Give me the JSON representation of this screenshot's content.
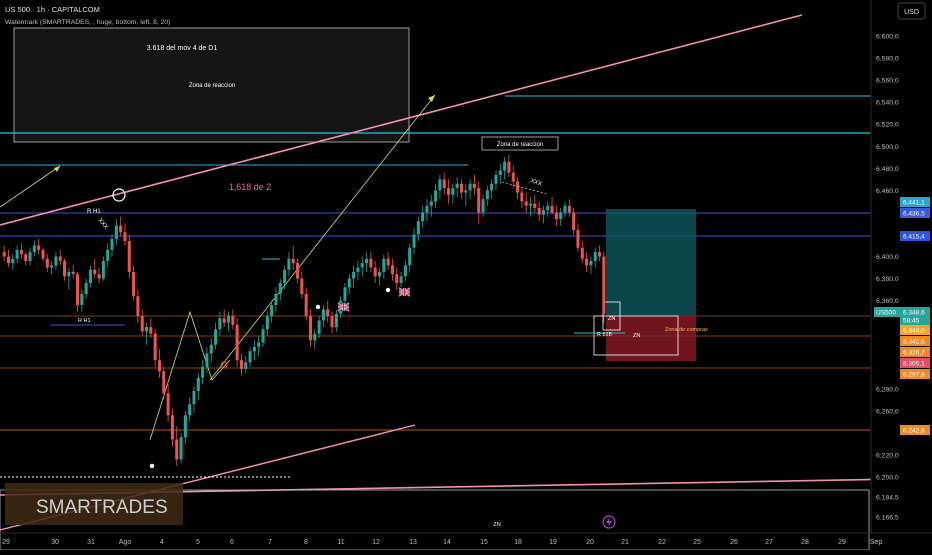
{
  "header": {
    "symbol_line": "US 500 · 1h · CAPITALCOM",
    "indicator_line": "Watermark (SMARTRADES, , huge, bottom, left, 8, 20)",
    "currency": "USD"
  },
  "chart_data": {
    "type": "candlestick",
    "y_ticks": [
      6600,
      6580,
      6560,
      6540,
      6520,
      6500,
      6480,
      6460,
      6440,
      6420,
      6400,
      6380,
      6360,
      6340,
      6320,
      6300,
      6280,
      6260,
      6240,
      6220,
      6200,
      6184.5,
      6166.5
    ],
    "y_tick_labels": [
      "6.600,0",
      "6.580,0",
      "6.560,0",
      "6.540,0",
      "6.520,0",
      "6.500,0",
      "6.480,0",
      "6.460,0",
      "",
      "",
      "6.400,0",
      "6.380,0",
      "6.360,0",
      "",
      "",
      "",
      "6.280,0",
      "6.260,0",
      "",
      "6.220,0",
      "6.200,0",
      "6.184,5",
      "6.166,5"
    ],
    "x_tick_labels": [
      "29",
      "30",
      "31",
      "Ago",
      "4",
      "5",
      "6",
      "7",
      "8",
      "11",
      "12",
      "13",
      "14",
      "15",
      "18",
      "19",
      "20",
      "21",
      "22",
      "25",
      "26",
      "27",
      "28",
      "29",
      "Sep"
    ],
    "price_badges": [
      {
        "value": "6.441,1",
        "color": "#26a6d1"
      },
      {
        "value": "6.436,5",
        "color": "#3a5bd9"
      },
      {
        "value": "6.415,4",
        "color": "#2e55e0"
      },
      {
        "value": "6.348,6",
        "color": "#26a69a"
      },
      {
        "value": "58:45",
        "color": "#26a69a"
      },
      {
        "value": "6.344,0",
        "color": "#f5a623"
      },
      {
        "value": "6.342,6",
        "color": "#f08a24"
      },
      {
        "value": "6.326,7",
        "color": "#f08a24"
      },
      {
        "value": "6.305,1",
        "color": "#e0506a"
      },
      {
        "value": "6.297,9",
        "color": "#f08a24"
      },
      {
        "value": "6.242,6",
        "color": "#f08a24"
      }
    ],
    "symbol_badge": "US500",
    "candles": [
      [
        6404,
        6410,
        6396,
        6400
      ],
      [
        6400,
        6406,
        6390,
        6394
      ],
      [
        6394,
        6402,
        6388,
        6398
      ],
      [
        6398,
        6410,
        6394,
        6406
      ],
      [
        6406,
        6412,
        6398,
        6402
      ],
      [
        6402,
        6404,
        6392,
        6396
      ],
      [
        6396,
        6408,
        6392,
        6404
      ],
      [
        6404,
        6414,
        6400,
        6410
      ],
      [
        6410,
        6416,
        6402,
        6406
      ],
      [
        6406,
        6408,
        6396,
        6398
      ],
      [
        6398,
        6402,
        6386,
        6390
      ],
      [
        6390,
        6396,
        6384,
        6392
      ],
      [
        6392,
        6404,
        6388,
        6400
      ],
      [
        6400,
        6406,
        6392,
        6396
      ],
      [
        6396,
        6398,
        6378,
        6382
      ],
      [
        6382,
        6390,
        6370,
        6386
      ],
      [
        6386,
        6392,
        6380,
        6384
      ],
      [
        6384,
        6386,
        6350,
        6356
      ],
      [
        6356,
        6370,
        6350,
        6366
      ],
      [
        6366,
        6380,
        6362,
        6376
      ],
      [
        6376,
        6392,
        6372,
        6388
      ],
      [
        6388,
        6398,
        6380,
        6384
      ],
      [
        6384,
        6390,
        6376,
        6380
      ],
      [
        6380,
        6400,
        6378,
        6396
      ],
      [
        6396,
        6412,
        6390,
        6406
      ],
      [
        6406,
        6420,
        6400,
        6416
      ],
      [
        6416,
        6434,
        6410,
        6428
      ],
      [
        6428,
        6436,
        6418,
        6422
      ],
      [
        6422,
        6430,
        6410,
        6414
      ],
      [
        6414,
        6420,
        6380,
        6386
      ],
      [
        6386,
        6392,
        6360,
        6364
      ],
      [
        6364,
        6370,
        6340,
        6346
      ],
      [
        6346,
        6352,
        6328,
        6332
      ],
      [
        6332,
        6340,
        6320,
        6336
      ],
      [
        6336,
        6344,
        6326,
        6330
      ],
      [
        6330,
        6334,
        6300,
        6306
      ],
      [
        6306,
        6316,
        6290,
        6296
      ],
      [
        6296,
        6300,
        6270,
        6276
      ],
      [
        6276,
        6284,
        6250,
        6256
      ],
      [
        6256,
        6262,
        6228,
        6234
      ],
      [
        6234,
        6246,
        6210,
        6216
      ],
      [
        6216,
        6240,
        6212,
        6236
      ],
      [
        6236,
        6260,
        6230,
        6256
      ],
      [
        6256,
        6272,
        6250,
        6266
      ],
      [
        6266,
        6282,
        6258,
        6278
      ],
      [
        6278,
        6294,
        6270,
        6290
      ],
      [
        6290,
        6306,
        6284,
        6300
      ],
      [
        6300,
        6318,
        6294,
        6312
      ],
      [
        6312,
        6326,
        6304,
        6320
      ],
      [
        6320,
        6340,
        6316,
        6334
      ],
      [
        6334,
        6350,
        6328,
        6344
      ],
      [
        6344,
        6352,
        6336,
        6340
      ],
      [
        6340,
        6350,
        6332,
        6346
      ],
      [
        6346,
        6352,
        6334,
        6338
      ],
      [
        6338,
        6344,
        6300,
        6306
      ],
      [
        6306,
        6312,
        6292,
        6298
      ],
      [
        6298,
        6310,
        6294,
        6304
      ],
      [
        6304,
        6318,
        6300,
        6314
      ],
      [
        6314,
        6324,
        6306,
        6318
      ],
      [
        6318,
        6328,
        6310,
        6322
      ],
      [
        6322,
        6338,
        6318,
        6334
      ],
      [
        6334,
        6350,
        6328,
        6346
      ],
      [
        6346,
        6360,
        6340,
        6356
      ],
      [
        6356,
        6372,
        6350,
        6366
      ],
      [
        6366,
        6380,
        6360,
        6376
      ],
      [
        6376,
        6392,
        6370,
        6388
      ],
      [
        6388,
        6404,
        6382,
        6398
      ],
      [
        6398,
        6410,
        6388,
        6394
      ],
      [
        6394,
        6398,
        6376,
        6380
      ],
      [
        6380,
        6386,
        6362,
        6366
      ],
      [
        6366,
        6372,
        6342,
        6346
      ],
      [
        6346,
        6352,
        6318,
        6324
      ],
      [
        6324,
        6334,
        6316,
        6330
      ],
      [
        6330,
        6346,
        6326,
        6342
      ],
      [
        6342,
        6356,
        6336,
        6352
      ],
      [
        6352,
        6360,
        6340,
        6346
      ],
      [
        6346,
        6350,
        6330,
        6336
      ],
      [
        6336,
        6352,
        6332,
        6348
      ],
      [
        6348,
        6364,
        6344,
        6360
      ],
      [
        6360,
        6376,
        6354,
        6372
      ],
      [
        6372,
        6384,
        6366,
        6380
      ],
      [
        6380,
        6392,
        6372,
        6386
      ],
      [
        6386,
        6396,
        6378,
        6390
      ],
      [
        6390,
        6400,
        6382,
        6394
      ],
      [
        6394,
        6404,
        6386,
        6398
      ],
      [
        6398,
        6404,
        6386,
        6390
      ],
      [
        6390,
        6396,
        6376,
        6382
      ],
      [
        6382,
        6390,
        6374,
        6386
      ],
      [
        6386,
        6402,
        6380,
        6398
      ],
      [
        6398,
        6404,
        6388,
        6392
      ],
      [
        6392,
        6398,
        6378,
        6384
      ],
      [
        6384,
        6390,
        6370,
        6376
      ],
      [
        6376,
        6386,
        6372,
        6382
      ],
      [
        6382,
        6396,
        6378,
        6392
      ],
      [
        6392,
        6412,
        6386,
        6408
      ],
      [
        6408,
        6426,
        6402,
        6420
      ],
      [
        6420,
        6436,
        6414,
        6432
      ],
      [
        6432,
        6446,
        6426,
        6440
      ],
      [
        6440,
        6452,
        6432,
        6446
      ],
      [
        6446,
        6456,
        6436,
        6450
      ],
      [
        6450,
        6466,
        6444,
        6460
      ],
      [
        6460,
        6474,
        6452,
        6470
      ],
      [
        6470,
        6476,
        6456,
        6462
      ],
      [
        6462,
        6470,
        6448,
        6456
      ],
      [
        6456,
        6466,
        6448,
        6462
      ],
      [
        6462,
        6472,
        6454,
        6466
      ],
      [
        6466,
        6470,
        6452,
        6458
      ],
      [
        6458,
        6466,
        6446,
        6460
      ],
      [
        6460,
        6470,
        6452,
        6466
      ],
      [
        6466,
        6474,
        6456,
        6462
      ],
      [
        6462,
        6468,
        6430,
        6440
      ],
      [
        6440,
        6456,
        6436,
        6452
      ],
      [
        6452,
        6464,
        6446,
        6460
      ],
      [
        6460,
        6470,
        6452,
        6466
      ],
      [
        6466,
        6478,
        6460,
        6474
      ],
      [
        6474,
        6484,
        6466,
        6478
      ],
      [
        6478,
        6490,
        6470,
        6486
      ],
      [
        6486,
        6492,
        6472,
        6476
      ],
      [
        6476,
        6482,
        6462,
        6468
      ],
      [
        6468,
        6472,
        6452,
        6458
      ],
      [
        6458,
        6462,
        6444,
        6450
      ],
      [
        6450,
        6458,
        6440,
        6446
      ],
      [
        6446,
        6454,
        6436,
        6448
      ],
      [
        6448,
        6456,
        6440,
        6444
      ],
      [
        6444,
        6450,
        6432,
        6438
      ],
      [
        6438,
        6446,
        6430,
        6442
      ],
      [
        6442,
        6450,
        6436,
        6446
      ],
      [
        6446,
        6454,
        6438,
        6440
      ],
      [
        6440,
        6446,
        6428,
        6434
      ],
      [
        6434,
        6444,
        6428,
        6440
      ],
      [
        6440,
        6450,
        6436,
        6446
      ],
      [
        6446,
        6452,
        6436,
        6440
      ],
      [
        6440,
        6444,
        6420,
        6424
      ],
      [
        6424,
        6430,
        6404,
        6408
      ],
      [
        6408,
        6414,
        6394,
        6398
      ],
      [
        6398,
        6404,
        6386,
        6392
      ],
      [
        6392,
        6400,
        6384,
        6396
      ],
      [
        6396,
        6408,
        6390,
        6404
      ],
      [
        6404,
        6410,
        6396,
        6400
      ],
      [
        6400,
        6404,
        6340,
        6348
      ]
    ]
  },
  "annotations": {
    "box_top_title": "3.618 del mov 4 de D1",
    "box_top_sub": "Zona de reaccion",
    "zona_reaccion_label": "Zona de reaccion",
    "fib_label": "1,618 de 2",
    "xxx_1": "XXX",
    "xxx_2": "XXX",
    "rh_1": "R H1",
    "rh_2": "R H1",
    "zn_1": "ZN",
    "zn_2": "ZN",
    "zn_3": "ZN",
    "r618": "R 618",
    "zona_compras": "Zona de compras",
    "watermark": "SMARTRADES"
  },
  "colors": {
    "bg": "#000000",
    "up": "#26a69a",
    "down": "#ef5350",
    "trend_pink": "#f48fb1",
    "cyan": "#26c6da",
    "blue": "#3f51d9",
    "orange": "#f57c00",
    "yellow": "#d4e157"
  }
}
